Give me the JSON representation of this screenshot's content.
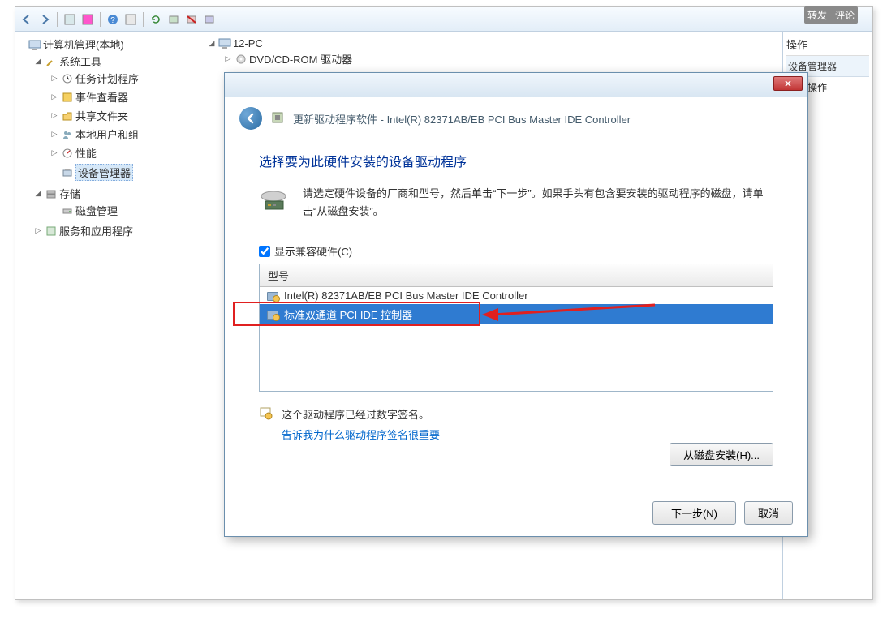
{
  "topbar": {
    "forward": "转发",
    "comment": "评论"
  },
  "tree": {
    "root": "计算机管理(本地)",
    "system_tools": "系统工具",
    "task_scheduler": "任务计划程序",
    "event_viewer": "事件查看器",
    "shared_folders": "共享文件夹",
    "local_users": "本地用户和组",
    "performance": "性能",
    "device_manager": "设备管理器",
    "storage": "存储",
    "disk_mgmt": "磁盘管理",
    "services_apps": "服务和应用程序"
  },
  "center": {
    "pc": "12-PC",
    "dvd": "DVD/CD-ROM 驱动器"
  },
  "right": {
    "header": "操作",
    "devmgr": "设备管理器",
    "more": "更多操作"
  },
  "dialog": {
    "title_prefix": "更新驱动程序软件 - ",
    "title_device": "Intel(R) 82371AB/EB PCI Bus Master IDE Controller",
    "heading": "选择要为此硬件安装的设备驱动程序",
    "instruction": "请选定硬件设备的厂商和型号，然后单击“下一步”。如果手头有包含要安装的驱动程序的磁盘，请单击“从磁盘安装”。",
    "show_compatible": "显示兼容硬件(C)",
    "col_model": "型号",
    "models": [
      "Intel(R) 82371AB/EB PCI Bus Master IDE Controller",
      "标准双通道 PCI IDE 控制器"
    ],
    "signed_text": "这个驱动程序已经过数字签名。",
    "signed_link": "告诉我为什么驱动程序签名很重要",
    "disk_install": "从磁盘安装(H)...",
    "next": "下一步(N)",
    "cancel": "取消"
  }
}
